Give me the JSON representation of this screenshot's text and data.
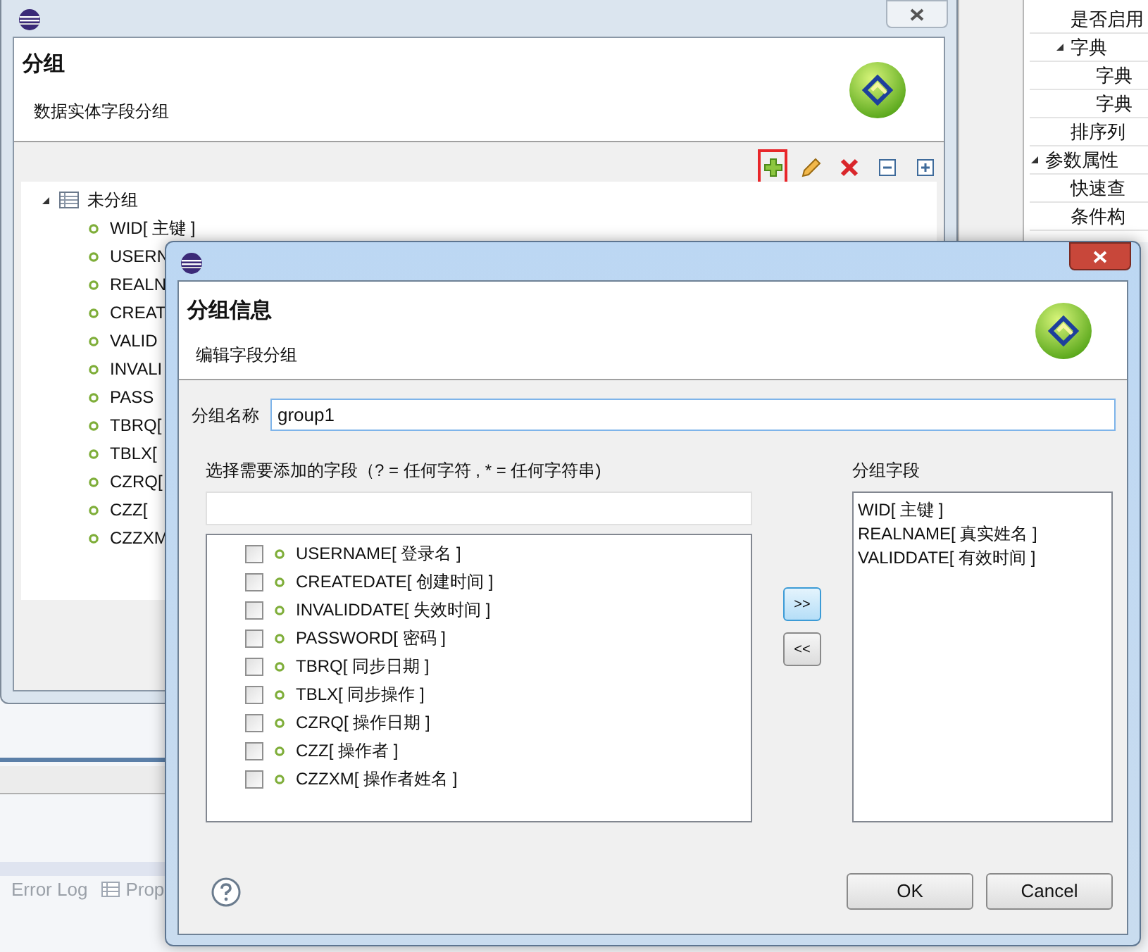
{
  "properties_panel": {
    "basic_section": {
      "children": [
        {
          "label": "是否启用"
        },
        {
          "label": "字典",
          "expanded": true,
          "children": [
            {
              "label": "字典"
            },
            {
              "label": "字典"
            }
          ]
        },
        {
          "label": "排序列"
        }
      ]
    },
    "param_section": {
      "label": "参数属性",
      "expanded": true,
      "children": [
        {
          "label": "快速查"
        },
        {
          "label": "条件构"
        }
      ]
    }
  },
  "bottom_tabs": [
    {
      "label": "Error Log",
      "kind": "log"
    },
    {
      "label": "Prop",
      "kind": "table"
    }
  ],
  "outer_dialog": {
    "title": "分组",
    "description": "数据实体字段分组",
    "toolbar": [
      {
        "kind": "add",
        "highlighted": true
      },
      {
        "kind": "edit",
        "highlighted": false
      },
      {
        "kind": "delete",
        "highlighted": false
      },
      {
        "kind": "collapse",
        "highlighted": false
      },
      {
        "kind": "expand",
        "highlighted": false
      }
    ],
    "tree": [
      {
        "label": "未分组",
        "expanded": true,
        "children": [
          {
            "label": "WID[ 主键 ]"
          },
          {
            "label": "USERN"
          },
          {
            "label": "REALN"
          },
          {
            "label": "CREAT"
          },
          {
            "label": "VALID"
          },
          {
            "label": "INVALI"
          },
          {
            "label": "PASS"
          },
          {
            "label": "TBRQ["
          },
          {
            "label": "TBLX["
          },
          {
            "label": "CZRQ["
          },
          {
            "label": "CZZ["
          },
          {
            "label": "CZZXM"
          }
        ]
      }
    ]
  },
  "inner_dialog": {
    "title": "分组信息",
    "description": "编辑字段分组",
    "name_label": "分组名称",
    "name_value": "group1",
    "available_label": "选择需要添加的字段（? = 任何字符 , * = 任何字符串)",
    "available_fields": [
      {
        "label": "USERNAME[ 登录名 ]",
        "checked": false
      },
      {
        "label": "CREATEDATE[ 创建时间 ]",
        "checked": false
      },
      {
        "label": "INVALIDDATE[ 失效时间 ]",
        "checked": false
      },
      {
        "label": "PASSWORD[ 密码 ]",
        "checked": false
      },
      {
        "label": "TBRQ[ 同步日期 ]",
        "checked": false
      },
      {
        "label": "TBLX[ 同步操作 ]",
        "checked": false
      },
      {
        "label": "CZRQ[ 操作日期 ]",
        "checked": false
      },
      {
        "label": "CZZ[ 操作者 ]",
        "checked": false
      },
      {
        "label": "CZZXM[ 操作者姓名 ]",
        "checked": false
      }
    ],
    "move_buttons": [
      {
        "label": ">>",
        "focused": true
      },
      {
        "label": "<<",
        "focused": false
      }
    ],
    "grouped_label": "分组字段",
    "grouped_fields": [
      "WID[ 主键 ]",
      "REALNAME[ 真实姓名 ]",
      "VALIDDATE[ 有效时间 ]"
    ],
    "buttons": [
      "OK",
      "Cancel"
    ]
  }
}
